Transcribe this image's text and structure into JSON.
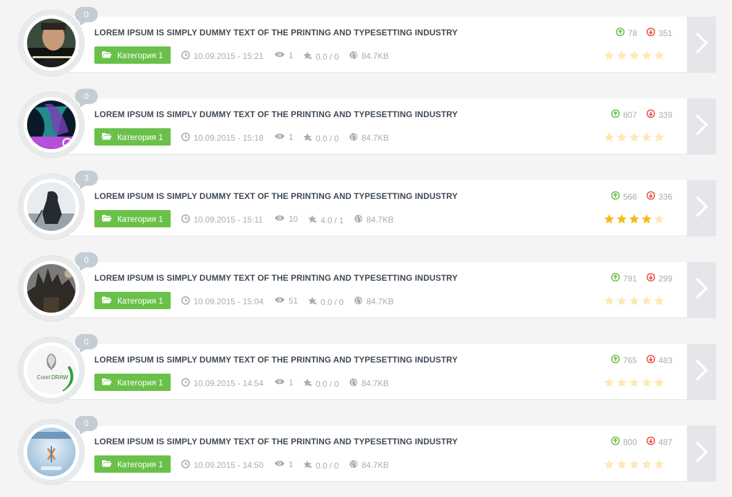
{
  "colors": {
    "accent_green": "#6ac14a",
    "up_vote": "#6ac14a",
    "down_vote": "#e5574b",
    "star_filled": "#f5bb1d",
    "star_empty": "#fde9b4"
  },
  "items": [
    {
      "comments": "0",
      "title": "LOREM IPSUM IS SIMPLY DUMMY TEXT OF THE PRINTING AND TYPESETTING INDUSTRY",
      "category": "Категория 1",
      "date": "10.09.2015 - 15:21",
      "views": "1",
      "rating_text": "0.0 / 0",
      "size": "84.7KB",
      "up": "78",
      "down": "351",
      "stars": 0,
      "thumb_icon": "movie-poster-icon"
    },
    {
      "comments": "0",
      "title": "LOREM IPSUM IS SIMPLY DUMMY TEXT OF THE PRINTING AND TYPESETTING INDUSTRY",
      "category": "Категория 1",
      "date": "10.09.2015 - 15:18",
      "views": "1",
      "rating_text": "0.0 / 0",
      "size": "84.7KB",
      "up": "807",
      "down": "339",
      "stars": 0,
      "thumb_icon": "premiere-pro-icon"
    },
    {
      "comments": "3",
      "title": "LOREM IPSUM IS SIMPLY DUMMY TEXT OF THE PRINTING AND TYPESETTING INDUSTRY",
      "category": "Категория 1",
      "date": "10.09.2015 - 15:11",
      "views": "10",
      "rating_text": "4.0 / 1",
      "size": "84.7KB",
      "up": "566",
      "down": "336",
      "stars": 4,
      "thumb_icon": "game-warrior-icon"
    },
    {
      "comments": "0",
      "title": "LOREM IPSUM IS SIMPLY DUMMY TEXT OF THE PRINTING AND TYPESETTING INDUSTRY",
      "category": "Категория 1",
      "date": "10.09.2015 - 15:04",
      "views": "51",
      "rating_text": "0.0 / 0",
      "size": "84.7KB",
      "up": "791",
      "down": "299",
      "stars": 0,
      "thumb_icon": "game-castle-icon"
    },
    {
      "comments": "0",
      "title": "LOREM IPSUM IS SIMPLY DUMMY TEXT OF THE PRINTING AND TYPESETTING INDUSTRY",
      "category": "Категория 1",
      "date": "10.09.2015 - 14:54",
      "views": "1",
      "rating_text": "0.0 / 0",
      "size": "84.7KB",
      "up": "765",
      "down": "483",
      "stars": 0,
      "thumb_icon": "coreldraw-icon"
    },
    {
      "comments": "0",
      "title": "LOREM IPSUM IS SIMPLY DUMMY TEXT OF THE PRINTING AND TYPESETTING INDUSTRY",
      "category": "Категория 1",
      "date": "10.09.2015 - 14:50",
      "views": "1",
      "rating_text": "0.0 / 0",
      "size": "84.7KB",
      "up": "800",
      "down": "487",
      "stars": 0,
      "thumb_icon": "powertools-icon"
    }
  ]
}
